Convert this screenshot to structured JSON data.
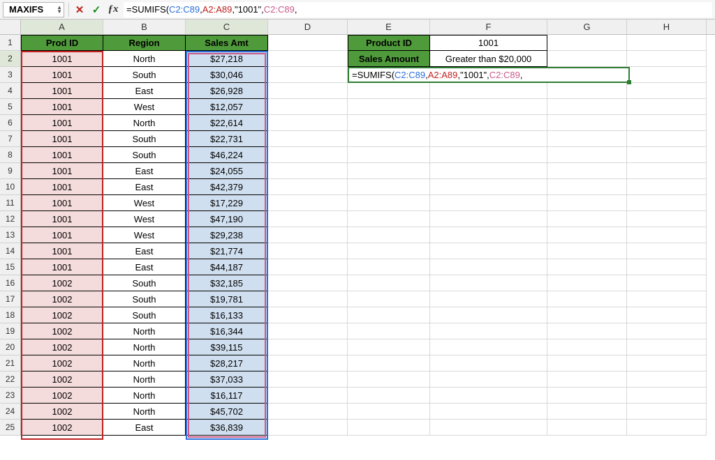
{
  "namebox": "MAXIFS",
  "formula": {
    "prefix": "=SUMIFS(",
    "r1": "C2:C89",
    "c1": ",",
    "r2": "A2:A89",
    "c2": ",\"1001\",",
    "r3": "C2:C89",
    "suffix": ","
  },
  "columns": [
    "A",
    "B",
    "C",
    "D",
    "E",
    "F",
    "G",
    "H"
  ],
  "headers": {
    "A": "Prod ID",
    "B": "Region",
    "C": "Sales Amt"
  },
  "side": {
    "E1": "Product ID",
    "F1": "1001",
    "E2": "Sales Amount",
    "F2": "Greater than $20,000"
  },
  "rows": [
    {
      "n": 2,
      "A": "1001",
      "B": "North",
      "C": "$27,218"
    },
    {
      "n": 3,
      "A": "1001",
      "B": "South",
      "C": "$30,046"
    },
    {
      "n": 4,
      "A": "1001",
      "B": "East",
      "C": "$26,928"
    },
    {
      "n": 5,
      "A": "1001",
      "B": "West",
      "C": "$12,057"
    },
    {
      "n": 6,
      "A": "1001",
      "B": "North",
      "C": "$22,614"
    },
    {
      "n": 7,
      "A": "1001",
      "B": "South",
      "C": "$22,731"
    },
    {
      "n": 8,
      "A": "1001",
      "B": "South",
      "C": "$46,224"
    },
    {
      "n": 9,
      "A": "1001",
      "B": "East",
      "C": "$24,055"
    },
    {
      "n": 10,
      "A": "1001",
      "B": "East",
      "C": "$42,379"
    },
    {
      "n": 11,
      "A": "1001",
      "B": "West",
      "C": "$17,229"
    },
    {
      "n": 12,
      "A": "1001",
      "B": "West",
      "C": "$47,190"
    },
    {
      "n": 13,
      "A": "1001",
      "B": "West",
      "C": "$29,238"
    },
    {
      "n": 14,
      "A": "1001",
      "B": "East",
      "C": "$21,774"
    },
    {
      "n": 15,
      "A": "1001",
      "B": "East",
      "C": "$44,187"
    },
    {
      "n": 16,
      "A": "1002",
      "B": "South",
      "C": "$32,185"
    },
    {
      "n": 17,
      "A": "1002",
      "B": "South",
      "C": "$19,781"
    },
    {
      "n": 18,
      "A": "1002",
      "B": "South",
      "C": "$16,133"
    },
    {
      "n": 19,
      "A": "1002",
      "B": "North",
      "C": "$16,344"
    },
    {
      "n": 20,
      "A": "1002",
      "B": "North",
      "C": "$39,115"
    },
    {
      "n": 21,
      "A": "1002",
      "B": "North",
      "C": "$28,217"
    },
    {
      "n": 22,
      "A": "1002",
      "B": "North",
      "C": "$37,033"
    },
    {
      "n": 23,
      "A": "1002",
      "B": "North",
      "C": "$16,117"
    },
    {
      "n": 24,
      "A": "1002",
      "B": "North",
      "C": "$45,702"
    },
    {
      "n": 25,
      "A": "1002",
      "B": "East",
      "C": "$36,839"
    }
  ]
}
